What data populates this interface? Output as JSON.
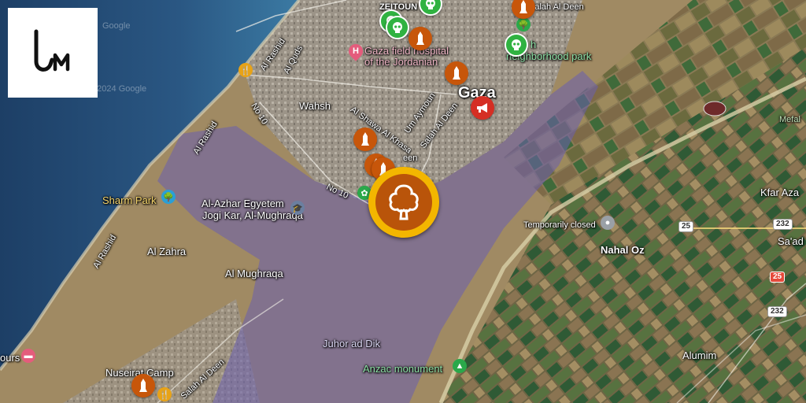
{
  "map": {
    "places": {
      "gaza": "Gaza",
      "zeitoun": "ZEITOUN",
      "wahsh": "Wahsh",
      "al_zahra": "Al Zahra",
      "al_mughraqa": "Al Mughraqa",
      "juhor_ad_dik": "Juhor ad Dik",
      "nuseirat_camp": "Nuseirat Camp",
      "kfar_aza": "Kfar Aza",
      "nahal_oz": "Nahal Oz",
      "alumim": "Alumim",
      "saad": "Sa'ad",
      "mefal": "Mefal",
      "ours": "ours"
    },
    "pois": {
      "hospital_line1": "Gaza field hospital",
      "hospital_line2": "of the Jordanian",
      "neighborhood_park": "neighborhood park",
      "neighborhood_park_prefix": "h",
      "sharm_park": "Sharm Park",
      "university_line1": "Al-Azhar Egyetem",
      "university_line2": "Jogi Kar, Al-Mughraqa",
      "anzac_monument": "Anzac monument",
      "temp_closed": "Temporarily closed"
    },
    "streets": {
      "al_rashid_north": "Al Rashid",
      "al_rashid_mid": "Al Rashid",
      "al_rashid_south": "Al Rashid",
      "al_quds": "Al Quds",
      "no10_north": "No 10",
      "no10_south": "No 10",
      "al_shawa": "Al Shawa Al Khasa",
      "um_aymoun": "Um Aymoun",
      "salah_al_deen_north": "Salah Al Deen",
      "salah_al_deen_mid": "Salah Al Deen",
      "salah_al_deen_south": "Salah Al Deen",
      "een": "een"
    },
    "road_badges": {
      "r25_a": "25",
      "r25_b": "25",
      "r232_a": "232",
      "r232_b": "232"
    },
    "watermarks": {
      "google1": "Google",
      "google2": "© 2024 Google"
    }
  },
  "markers": {
    "main": {
      "icon": "tree-icon",
      "fill": "#b9540a",
      "ring": "#f3b600"
    },
    "colors": {
      "orange": "#c7560a",
      "green": "#30b241",
      "red": "#d52f24"
    }
  },
  "logo": {
    "alt": "um"
  }
}
